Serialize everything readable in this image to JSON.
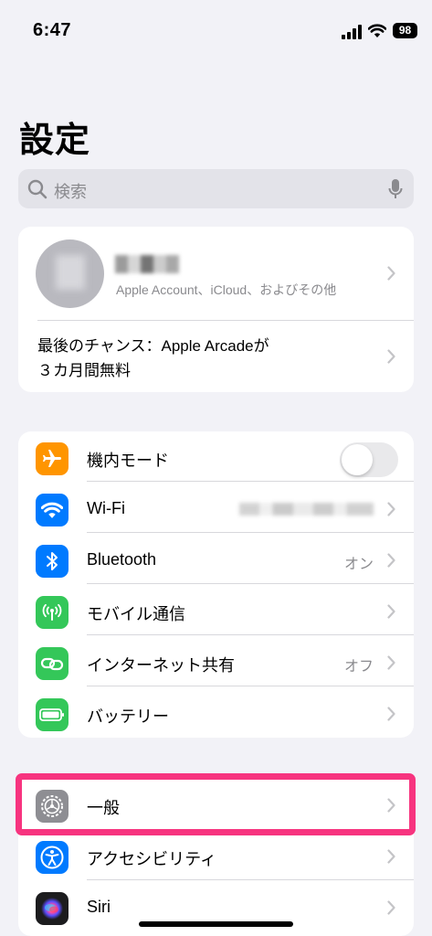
{
  "status_bar": {
    "time": "6:47",
    "battery": "98"
  },
  "title": "設定",
  "search": {
    "placeholder": "検索"
  },
  "account": {
    "subtitle": "Apple Account、iCloud、およびその他",
    "promo_line1": "最後のチャンス：Apple Arcadeが",
    "promo_line2": "３カ月間無料"
  },
  "settings_group": [
    {
      "label": "機内モード",
      "icon": "airplane-icon",
      "color": "#ff9500"
    },
    {
      "label": "Wi-Fi",
      "icon": "wifi-icon",
      "color": "#007aff"
    },
    {
      "label": "Bluetooth",
      "value": "オン",
      "icon": "bluetooth-icon",
      "color": "#007aff"
    },
    {
      "label": "モバイル通信",
      "icon": "antenna-icon",
      "color": "#34c759"
    },
    {
      "label": "インターネット共有",
      "value": "オフ",
      "icon": "link-icon",
      "color": "#34c759"
    },
    {
      "label": "バッテリー",
      "icon": "battery-icon",
      "color": "#34c759"
    }
  ],
  "general_group": [
    {
      "label": "一般",
      "icon": "gear-icon",
      "color": "#8e8e93"
    },
    {
      "label": "アクセシビリティ",
      "icon": "accessibility-icon",
      "color": "#007aff"
    },
    {
      "label": "Siri",
      "icon": "siri-icon",
      "color": "#1c1c1e"
    }
  ],
  "highlight_color": "#f7347f",
  "airplane_mode_on": false
}
